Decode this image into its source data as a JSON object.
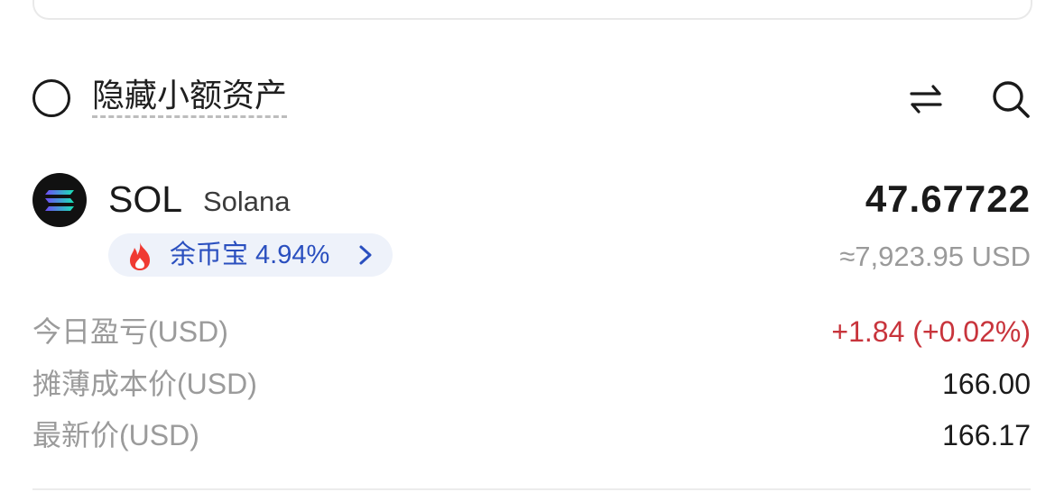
{
  "filter": {
    "hide_small_label": "隐藏小额资产",
    "hide_small_checked": false
  },
  "icons": {
    "sort": "sort-arrows-icon",
    "search": "search-icon",
    "asset_logo": "solana-logo-icon",
    "fire": "fire-icon",
    "chevron": "chevron-right-icon"
  },
  "asset": {
    "symbol": "SOL",
    "name": "Solana",
    "amount": "47.67722",
    "usd_value": "≈7,923.95 USD",
    "earn_label": "余币宝 4.94%"
  },
  "stats": [
    {
      "label": "今日盈亏(USD)",
      "value": "+1.84 (+0.02%)"
    },
    {
      "label": "摊薄成本价(USD)",
      "value": "166.00"
    },
    {
      "label": "最新价(USD)",
      "value": "166.17"
    }
  ],
  "colors": {
    "profit": "#c8343c",
    "earn_text": "#2a4fbf",
    "earn_bg": "#eef2fa",
    "muted": "#9b9b9b"
  }
}
